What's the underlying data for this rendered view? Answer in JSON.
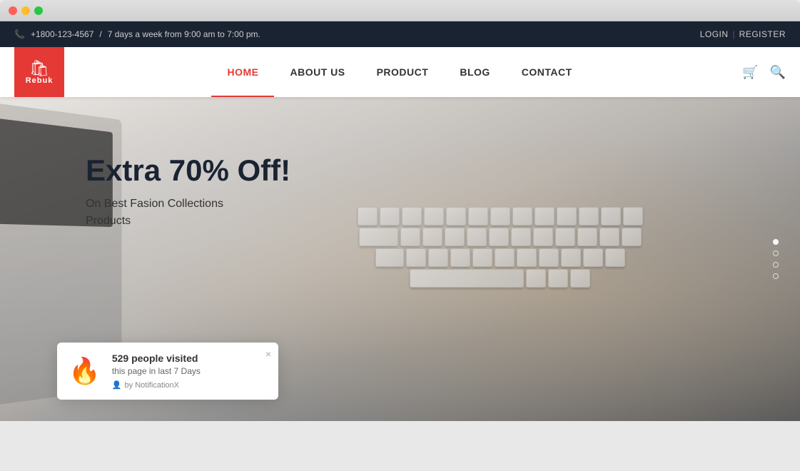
{
  "browser": {
    "dots": [
      "red",
      "yellow",
      "green"
    ]
  },
  "topbar": {
    "phone_icon": "📞",
    "phone": "+1800-123-4567",
    "separator": "/",
    "hours": "7 days a week from 9:00 am to 7:00 pm.",
    "login_label": "LOGIN",
    "separator2": "|",
    "register_label": "REGISTER"
  },
  "header": {
    "logo_text": "Rebuk",
    "logo_icon": "🛍",
    "nav_items": [
      {
        "label": "HOME",
        "active": true
      },
      {
        "label": "ABOUT US",
        "active": false
      },
      {
        "label": "PRODUCT",
        "active": false
      },
      {
        "label": "BLOG",
        "active": false
      },
      {
        "label": "CONTACT",
        "active": false
      }
    ],
    "cart_icon": "🛒",
    "search_icon": "🔍"
  },
  "hero": {
    "title": "Extra 70% Off!",
    "subtitle_line1": "On Best Fasion Collections",
    "subtitle_line2": "Products"
  },
  "slider": {
    "dots": [
      true,
      false,
      false,
      false
    ]
  },
  "notification": {
    "fire_icon": "🔥",
    "title": "529 people visited",
    "subtitle": "this page in last 7 Days",
    "footer_icon": "👤",
    "footer_text": "by NotificationX",
    "close_icon": "×"
  }
}
